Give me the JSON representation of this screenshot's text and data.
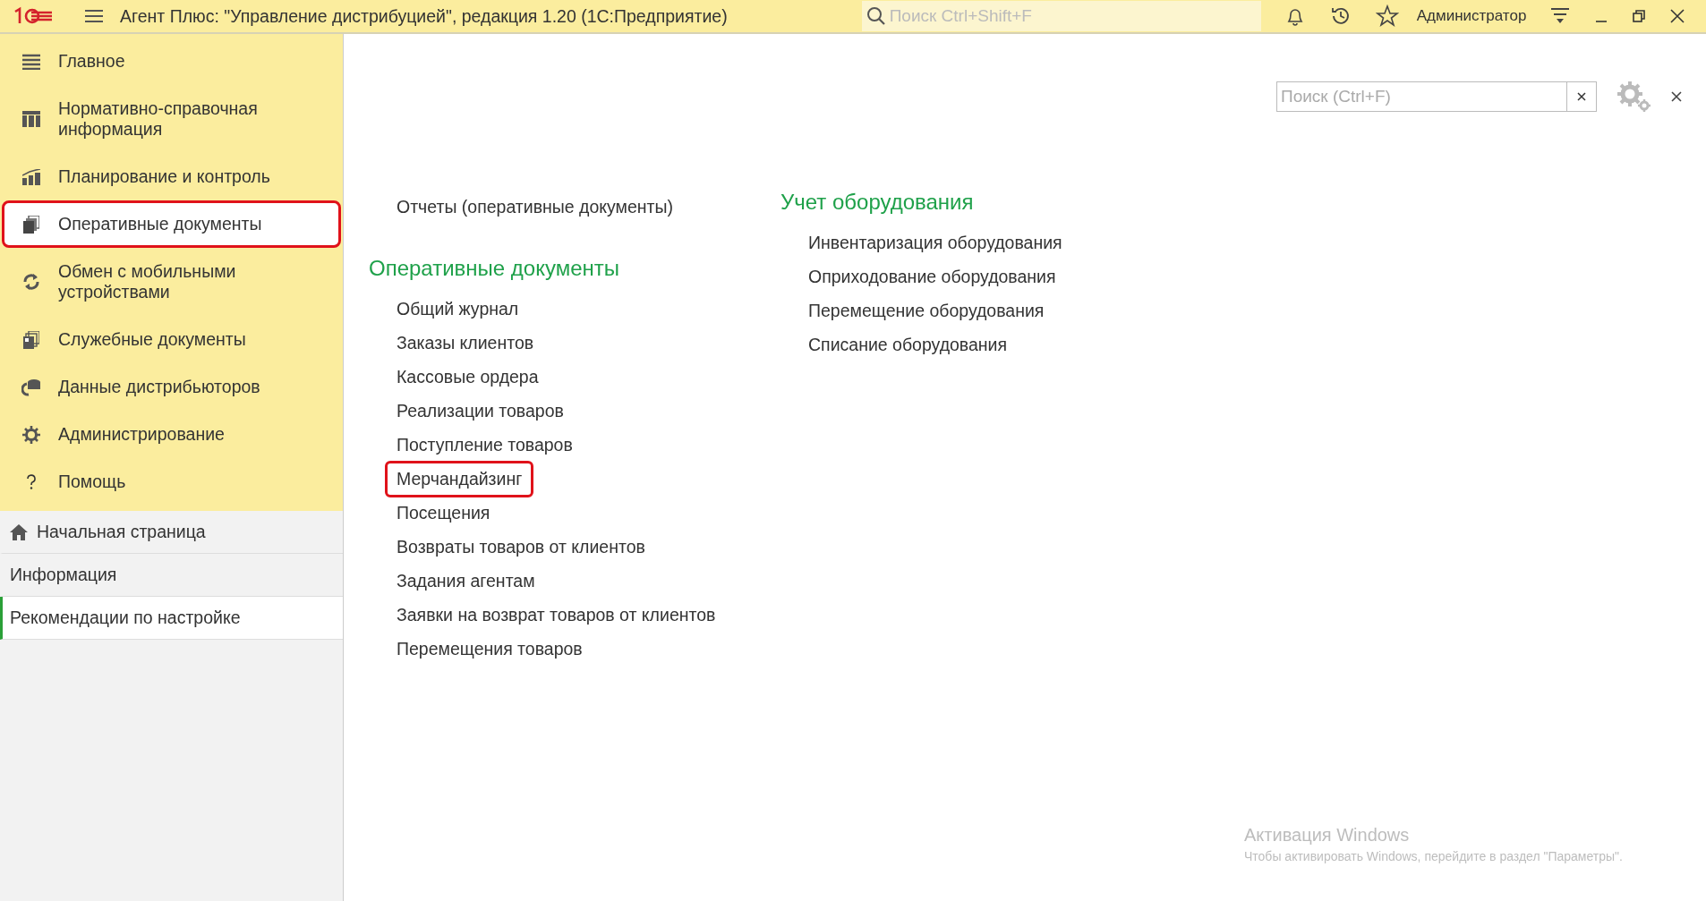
{
  "title_bar": {
    "title": "Агент Плюс: \"Управление дистрибуцией\", редакция 1.20  (1С:Предприятие)",
    "search": {
      "placeholder": "Поиск Ctrl+Shift+F"
    },
    "user": "Администратор"
  },
  "sidebar": {
    "sections": [
      {
        "label": "Главное",
        "selected": false,
        "highlighted": false
      },
      {
        "label": "Нормативно-справочная информация",
        "selected": false,
        "highlighted": false
      },
      {
        "label": "Планирование и контроль",
        "selected": false,
        "highlighted": false
      },
      {
        "label": "Оперативные документы",
        "selected": true,
        "highlighted": true
      },
      {
        "label": "Обмен с мобильными устройствами",
        "selected": false,
        "highlighted": false
      },
      {
        "label": "Служебные документы",
        "selected": false,
        "highlighted": false
      },
      {
        "label": "Данные дистрибьюторов",
        "selected": false,
        "highlighted": false
      },
      {
        "label": "Администрирование",
        "selected": false,
        "highlighted": false
      },
      {
        "label": "Помощь",
        "selected": false,
        "highlighted": false
      }
    ],
    "nav": [
      {
        "label": "Начальная страница",
        "selected": false
      },
      {
        "label": "Информация",
        "selected": false
      },
      {
        "label": "Рекомендации по настройке",
        "selected": true
      }
    ]
  },
  "panel": {
    "search": {
      "placeholder": "Поиск (Ctrl+F)"
    },
    "columns": [
      {
        "groups": [
          {
            "links": [
              {
                "label": "Отчеты (оперативные документы)",
                "highlighted": false
              }
            ]
          },
          {
            "heading": "Оперативные документы",
            "links": [
              {
                "label": "Общий журнал",
                "highlighted": false
              },
              {
                "label": "Заказы клиентов",
                "highlighted": false
              },
              {
                "label": "Кассовые ордера",
                "highlighted": false
              },
              {
                "label": "Реализации товаров",
                "highlighted": false
              },
              {
                "label": "Поступление товаров",
                "highlighted": false
              },
              {
                "label": "Мерчандайзинг",
                "highlighted": true
              },
              {
                "label": "Посещения",
                "highlighted": false
              },
              {
                "label": "Возвраты товаров от клиентов",
                "highlighted": false
              },
              {
                "label": "Задания агентам",
                "highlighted": false
              },
              {
                "label": "Заявки на возврат товаров от клиентов",
                "highlighted": false
              },
              {
                "label": "Перемещения товаров",
                "highlighted": false
              }
            ]
          }
        ]
      },
      {
        "groups": [
          {
            "heading": "Учет оборудования",
            "links": [
              {
                "label": "Инвентаризация оборудования",
                "highlighted": false
              },
              {
                "label": "Оприходование оборудования",
                "highlighted": false
              },
              {
                "label": "Перемещение оборудования",
                "highlighted": false
              },
              {
                "label": "Списание оборудования",
                "highlighted": false
              }
            ]
          }
        ]
      }
    ]
  },
  "activation_notice": {
    "title": "Активация Windows",
    "text": "Чтобы активировать Windows, перейдите в раздел \"Параметры\"."
  }
}
